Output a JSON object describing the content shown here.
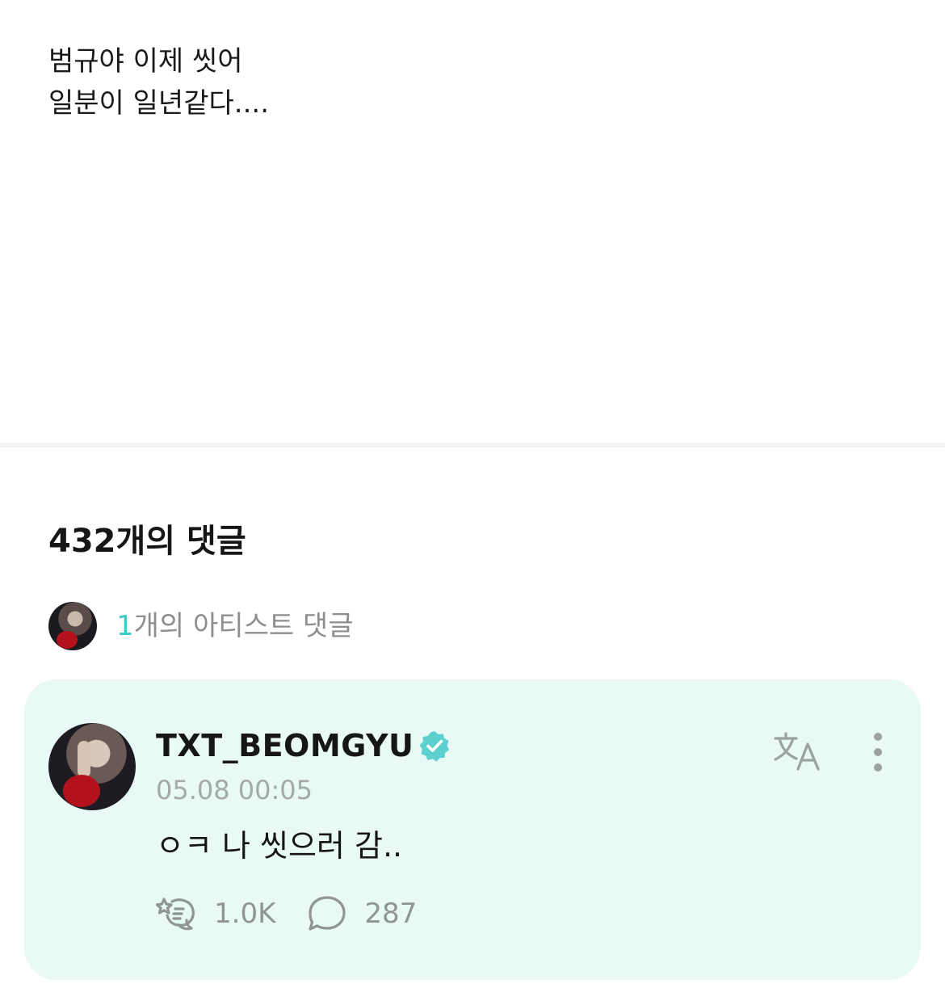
{
  "post": {
    "lines": [
      "범규야 이제 씻어",
      "일분이 일년같다...."
    ]
  },
  "comments": {
    "title": "432개의 댓글",
    "artist_summary": {
      "count": "1",
      "label": "개의 아티스트 댓글"
    }
  },
  "artist_comment": {
    "username": "TXT_BEOMGYU",
    "timestamp": "05.08 00:05",
    "body": "ㅇㅋ 나 씻으러 감..",
    "like_count": "1.0K",
    "reply_count": "287",
    "icons": {
      "verified": "verified-badge-icon",
      "translate": "translate-icon",
      "more": "more-vertical-icon",
      "like": "cheer-icon",
      "reply": "comment-bubble-icon"
    }
  },
  "colors": {
    "accent": "#3fc9c9",
    "card_background": "#e8f9f6",
    "muted_text": "#8f9594"
  }
}
